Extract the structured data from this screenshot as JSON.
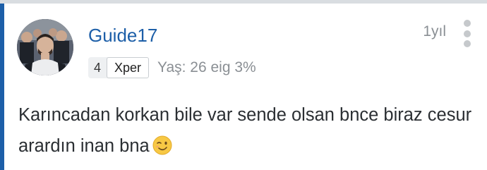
{
  "comment": {
    "author": "Guide17",
    "time_ago": "1yıl",
    "badge": {
      "level": "4",
      "tag": "Xper"
    },
    "meta": "Yaş: 26 eig 3%",
    "text": "Karıncadan korkan bile var sende olsan bnce biraz cesur arardın inan bna",
    "emoji_icon": "winking-face-icon",
    "menu_icon": "more-vertical-icon",
    "accent_color": "#1d5fa8"
  }
}
